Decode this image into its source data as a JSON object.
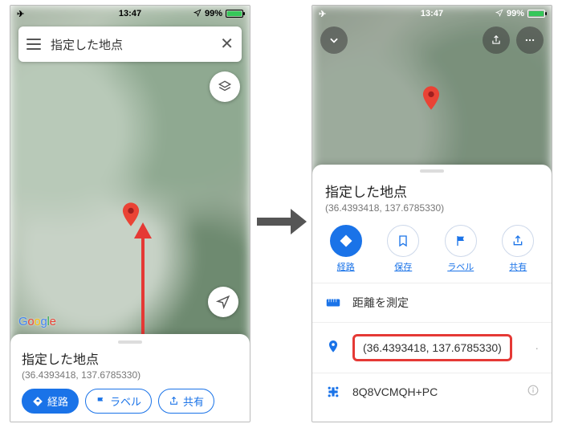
{
  "status": {
    "time": "13:47",
    "battery": "99%",
    "airplane": "✈"
  },
  "left": {
    "search_text": "指定した地点",
    "google": [
      "G",
      "o",
      "o",
      "g",
      "l",
      "e"
    ],
    "card_title": "指定した地点",
    "card_coords": "(36.4393418, 137.6785330)",
    "pill_route": "経路",
    "pill_label": "ラベル",
    "pill_share": "共有"
  },
  "right": {
    "sheet_title": "指定した地点",
    "sheet_coords": "(36.4393418, 137.6785330)",
    "action_route": "経路",
    "action_save": "保存",
    "action_label": "ラベル",
    "action_share": "共有",
    "row_measure": "距離を測定",
    "row_coords": "(36.4393418, 137.6785330)",
    "row_pluscode": "8Q8VCMQH+PC"
  }
}
